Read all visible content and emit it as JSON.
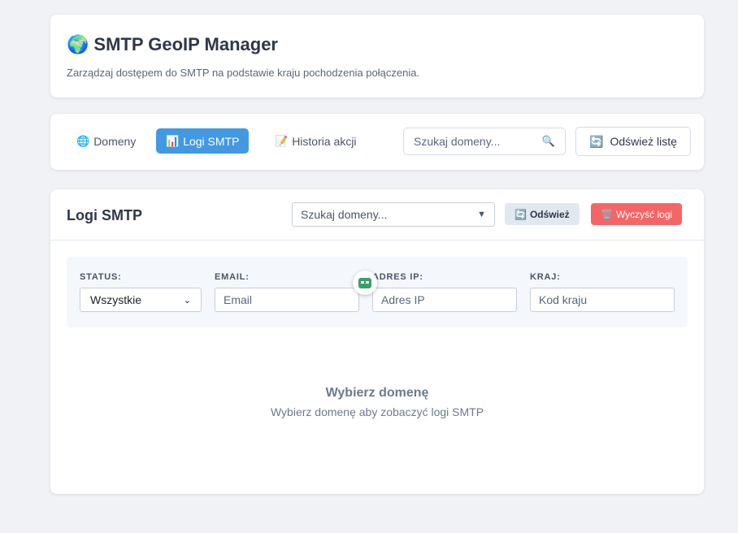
{
  "header": {
    "title_icon": "🌍",
    "title": "SMTP GeoIP Manager",
    "subtitle": "Zarządzaj dostępem do SMTP na podstawie kraju pochodzenia połączenia."
  },
  "nav": {
    "tabs": [
      {
        "icon": "🌐",
        "label": "Domeny",
        "active": false
      },
      {
        "icon": "📊",
        "label": "Logi SMTP",
        "active": true
      },
      {
        "icon": "📝",
        "label": "Historia akcji",
        "active": false
      }
    ],
    "search_placeholder": "Szukaj domeny...",
    "search_icon": "🔍",
    "refresh_icon": "🔄",
    "refresh_label": "Odśwież listę"
  },
  "logs": {
    "title": "Logi SMTP",
    "domain_select_value": "Szukaj domeny...",
    "refresh_icon": "🔄",
    "refresh_label": "Odśwież",
    "clear_icon": "🗑️",
    "clear_label": "Wyczyść logi",
    "filters": {
      "status_label": "STATUS:",
      "status_value": "Wszystkie",
      "email_label": "EMAIL:",
      "email_placeholder": "Email",
      "ip_label": "ADRES IP:",
      "ip_placeholder": "Adres IP",
      "country_label": "KRAJ:",
      "country_placeholder": "Kod kraju"
    },
    "empty_title": "Wybierz domenę",
    "empty_subtitle": "Wybierz domenę aby zobaczyć logi SMTP"
  },
  "colors": {
    "accent": "#4299e1",
    "danger": "#f56565",
    "background": "#f0f2f5"
  }
}
